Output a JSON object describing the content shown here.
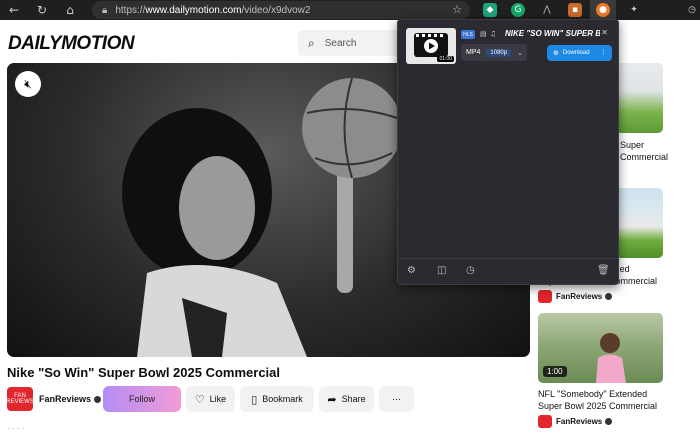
{
  "browser": {
    "url_prefix": "https://",
    "url_domain": "www.dailymotion.com",
    "url_path": "/video/x9dvow2"
  },
  "site": {
    "logo": "DAILYMOTION",
    "search_placeholder": "Search"
  },
  "video": {
    "title": "Nike \"So Win\" Super Bowl 2025 Commercial",
    "channel": "FanReviews",
    "channel_avatar_text": "FAN REVIEWS",
    "actions": {
      "follow": "Follow",
      "like": "Like",
      "bookmark": "Bookmark",
      "share": "Share",
      "more": "⋯"
    }
  },
  "recommendations": [
    {
      "title_partial_line1": "Super",
      "title_partial_line2": "Commercial"
    },
    {
      "title_line1": "NFL \"Alright\" Extended",
      "title_line2": "Super Bowl 2025 Commercial",
      "channel": "FanReviews"
    },
    {
      "title_line1": "NFL \"Somebody\" Extended",
      "title_line2": "Super Bowl 2025 Commercial",
      "channel": "FanReviews",
      "duration": "1:00"
    }
  ],
  "extension_popup": {
    "item_title": "NIKE \"SO WIN\" SUPER B...",
    "badge": "HLS",
    "thumb_duration": "01:00",
    "format": "MP4",
    "quality": "1080p",
    "download_label": "Download"
  },
  "colors": {
    "brand_red": "#e1262d",
    "popup_bg": "#2a2a30",
    "download_blue": "#1e88e5",
    "follow_gradient_start": "#b48cf5",
    "follow_gradient_end": "#f29cd6"
  }
}
